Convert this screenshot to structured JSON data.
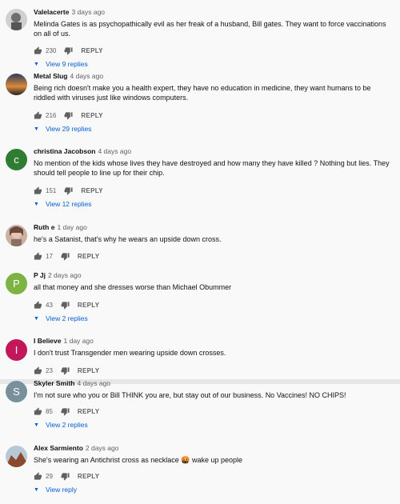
{
  "comments": [
    {
      "author": "Valelacerte",
      "time": "3 days ago",
      "text": "Melinda Gates is as psychopathically evil as her freak of a husband, Bill gates. They want to force vaccinations on all of us.",
      "likes": "230",
      "reply_label": "REPLY",
      "view_replies": "View 9 replies",
      "avatar": {
        "letter": "",
        "color": "#8a8a8a"
      }
    },
    {
      "author": "Metal Slug",
      "time": "4 days ago",
      "text": "Being rich doesn't make you a health expert, they have no education in medicine, they want humans to be riddled with viruses just like windows computers.",
      "likes": "216",
      "reply_label": "REPLY",
      "view_replies": "View 29 replies",
      "avatar": {
        "letter": "",
        "color": "#3b4a6b"
      }
    },
    {
      "author": "christina Jacobson",
      "time": "4 days ago",
      "text": "No mention of the kids whose lives they have destroyed and how many they have killed ? Nothing but lies. They should tell people to line up for their chip.",
      "likes": "151",
      "reply_label": "REPLY",
      "view_replies": "View 12 replies",
      "avatar": {
        "letter": "c",
        "color": "#2e7d32"
      }
    },
    {
      "author": "Ruth e",
      "time": "1 day ago",
      "text": "he's a Satanist, that's why he wears an upside down cross.",
      "likes": "17",
      "reply_label": "REPLY",
      "view_replies": "",
      "avatar": {
        "letter": "",
        "color": "#b48a7a"
      }
    },
    {
      "author": "P Jj",
      "time": "2 days ago",
      "text": "all that money and she dresses worse than Michael Obummer",
      "likes": "43",
      "reply_label": "REPLY",
      "view_replies": "View 2 replies",
      "avatar": {
        "letter": "P",
        "color": "#7cb342"
      }
    },
    {
      "author": "I Believe",
      "time": "1 day ago",
      "text": "I don't trust Transgender men wearing upside down crosses.",
      "likes": "23",
      "reply_label": "REPLY",
      "view_replies": "",
      "avatar": {
        "letter": "I",
        "color": "#c2185b"
      }
    },
    {
      "author": "Skyler Smith",
      "time": "4 days ago",
      "text": "I'm not sure who you or Bill THINK you are, but stay out of our business. No Vaccines! NO CHIPS!",
      "likes": "85",
      "reply_label": "REPLY",
      "view_replies": "View 2 replies",
      "avatar": {
        "letter": "S",
        "color": "#78909c"
      }
    },
    {
      "author": "Alex Sarmiento",
      "time": "2 days ago",
      "text": "She's wearing an Antichrist cross as necklace 🤬 wake up people",
      "likes": "29",
      "reply_label": "REPLY",
      "view_replies": "View reply",
      "avatar": {
        "letter": "",
        "color": "#a0522d"
      }
    }
  ]
}
